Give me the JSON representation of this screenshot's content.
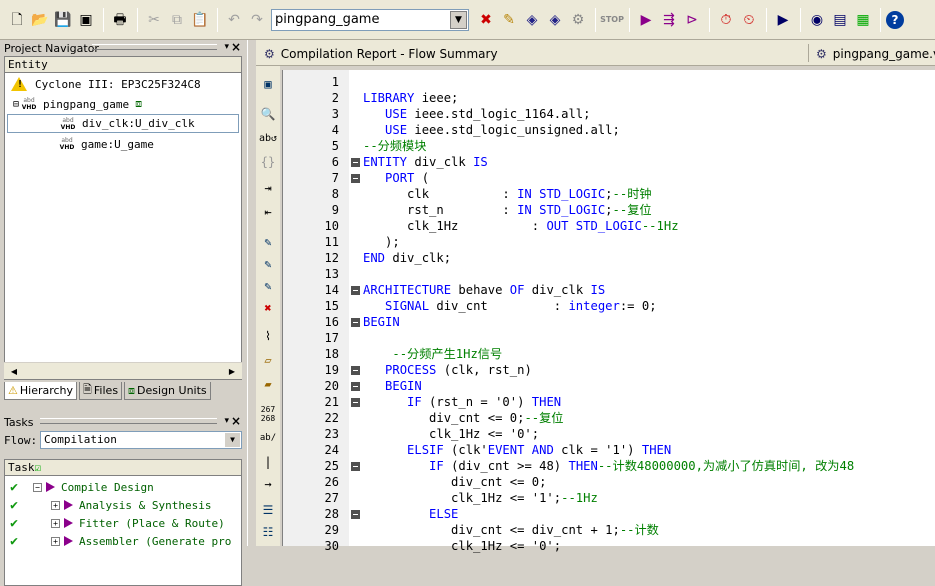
{
  "toolbar": {
    "project_select": "pingpang_game",
    "icons": [
      "new-file-icon",
      "open-folder-icon",
      "save-icon",
      "save-all-icon",
      "print-icon",
      "cut-icon",
      "copy-icon",
      "paste-icon",
      "undo-icon",
      "redo-icon"
    ]
  },
  "project_navigator": {
    "title": "Project Navigator",
    "header": "Entity",
    "device": "Cyclone III: EP3C25F324C8",
    "top": "pingpang_game",
    "children": [
      "div_clk:U_div_clk",
      "game:U_game"
    ],
    "tabs": [
      "Hierarchy",
      "Files",
      "Design Units"
    ]
  },
  "tasks": {
    "title": "Tasks",
    "flow_label": "Flow:",
    "flow_value": "Compilation",
    "header": "Task",
    "items": [
      "Compile Design",
      "Analysis & Synthesis",
      "Fitter (Place & Route)",
      "Assembler (Generate pro"
    ]
  },
  "doc_tabs": {
    "report": "Compilation Report - Flow Summary",
    "file": "pingpang_game.vhd"
  },
  "side_tools": {
    "line_counter_top": "267",
    "line_counter_bottom": "268",
    "ab_label": "ab/"
  },
  "code_lines": [
    "",
    "LIBRARY ieee;",
    "   USE ieee.std_logic_1164.all;",
    "   USE ieee.std_logic_unsigned.all;",
    "--分频模块",
    "ENTITY div_clk IS",
    "   PORT (",
    "      clk          : IN STD_LOGIC;--时钟",
    "      rst_n        : IN STD_LOGIC;--复位",
    "      clk_1Hz          : OUT STD_LOGIC--1Hz",
    "   );",
    "END div_clk;",
    "",
    "ARCHITECTURE behave OF div_clk IS",
    "   SIGNAL div_cnt         : integer:= 0;",
    "BEGIN",
    "",
    "    --分频产生1Hz信号",
    "   PROCESS (clk, rst_n)",
    "   BEGIN",
    "      IF (rst_n = '0') THEN",
    "         div_cnt <= 0;--复位",
    "         clk_1Hz <= '0';",
    "      ELSIF (clk'EVENT AND clk = '1') THEN",
    "         IF (div_cnt >= 48) THEN--计数48000000,为减小了仿真时间, 改为48",
    "            div_cnt <= 0;",
    "            clk_1Hz <= '1';--1Hz",
    "         ELSE",
    "            div_cnt <= div_cnt + 1;--计数",
    "            clk_1Hz <= '0';"
  ]
}
